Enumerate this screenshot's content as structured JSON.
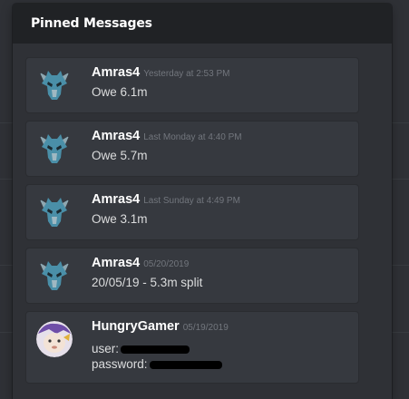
{
  "popout": {
    "title": "Pinned Messages"
  },
  "messages": [
    {
      "author": "Amras4",
      "timestamp": "Yesterday at 2:53 PM",
      "content": "Owe 6.1m",
      "avatar": "dragon-avatar"
    },
    {
      "author": "Amras4",
      "timestamp": "Last Monday at 4:40 PM",
      "content": "Owe 5.7m",
      "avatar": "dragon-avatar"
    },
    {
      "author": "Amras4",
      "timestamp": "Last Sunday at 4:49 PM",
      "content": "Owe 3.1m",
      "avatar": "dragon-avatar"
    },
    {
      "author": "Amras4",
      "timestamp": "05/20/2019",
      "content": "20/05/19 - 5.3m split",
      "avatar": "dragon-avatar"
    },
    {
      "author": "HungryGamer",
      "timestamp": "05/19/2019",
      "line1": "user:",
      "line2": "password:",
      "avatar": "baby-avatar"
    }
  ],
  "colors": {
    "header_bg": "#202225",
    "card_bg": "#36393f",
    "timestamp": "#72767d",
    "text": "#dcddde"
  }
}
